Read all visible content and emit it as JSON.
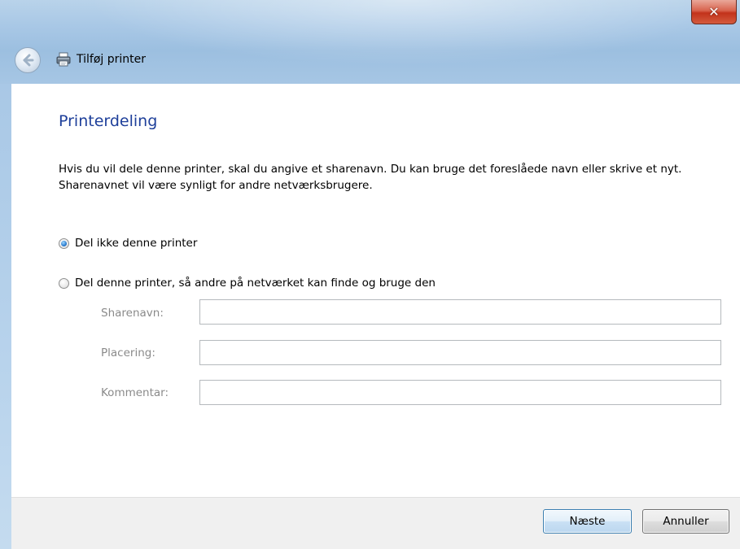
{
  "window": {
    "title": "Tilføj printer",
    "close_glyph": "✕"
  },
  "icons": {
    "back": "back-arrow-icon",
    "printer": "printer-icon",
    "close": "close-icon"
  },
  "page": {
    "heading": "Printerdeling",
    "description": "Hvis du vil dele denne printer, skal du angive et sharenavn. Du kan bruge det foreslåede navn eller skrive et nyt. Sharenavnet vil være synligt for andre netværksbrugere."
  },
  "options": {
    "dont_share": {
      "label": "Del ikke denne printer",
      "selected": true
    },
    "share": {
      "label": "Del denne printer, så andre på netværket kan finde og bruge den",
      "selected": false
    }
  },
  "fields": {
    "share_name": {
      "label": "Sharenavn:",
      "value": ""
    },
    "location": {
      "label": "Placering:",
      "value": ""
    },
    "comment": {
      "label": "Kommentar:",
      "value": ""
    }
  },
  "buttons": {
    "next": "Næste",
    "cancel": "Annuller"
  },
  "colors": {
    "heading": "#1e3f9a",
    "disabled_label": "#8a8a8a",
    "close_button": "#c2321b"
  }
}
